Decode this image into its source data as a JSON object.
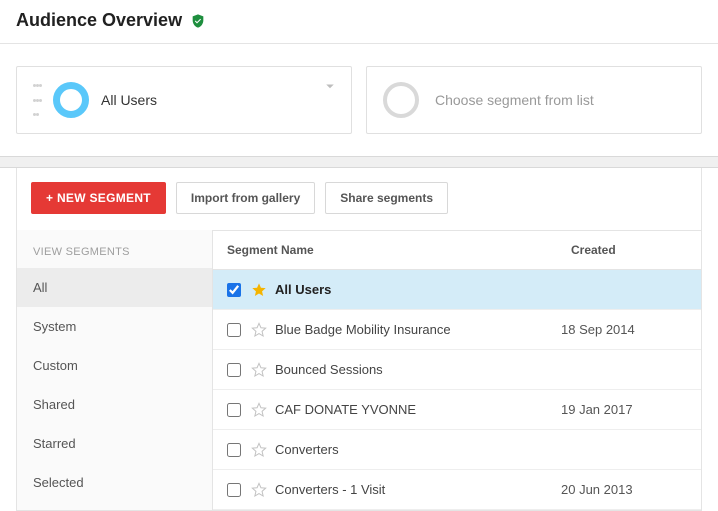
{
  "header": {
    "title": "Audience Overview"
  },
  "segSelector": {
    "current": "All Users",
    "choose": "Choose segment from list"
  },
  "toolbar": {
    "new": "+ NEW SEGMENT",
    "import": "Import from gallery",
    "share": "Share segments"
  },
  "sidebar": {
    "title": "VIEW SEGMENTS",
    "items": [
      "All",
      "System",
      "Custom",
      "Shared",
      "Starred",
      "Selected"
    ]
  },
  "table": {
    "headers": {
      "name": "Segment Name",
      "created": "Created"
    },
    "rows": [
      {
        "name": "All Users",
        "created": "",
        "checked": true,
        "starred": true
      },
      {
        "name": "Blue Badge Mobility Insurance",
        "created": "18 Sep 2014",
        "checked": false,
        "starred": false
      },
      {
        "name": "Bounced Sessions",
        "created": "",
        "checked": false,
        "starred": false
      },
      {
        "name": "CAF DONATE YVONNE",
        "created": "19 Jan 2017",
        "checked": false,
        "starred": false
      },
      {
        "name": "Converters",
        "created": "",
        "checked": false,
        "starred": false
      },
      {
        "name": "Converters - 1 Visit",
        "created": "20 Jun 2013",
        "checked": false,
        "starred": false
      }
    ]
  }
}
